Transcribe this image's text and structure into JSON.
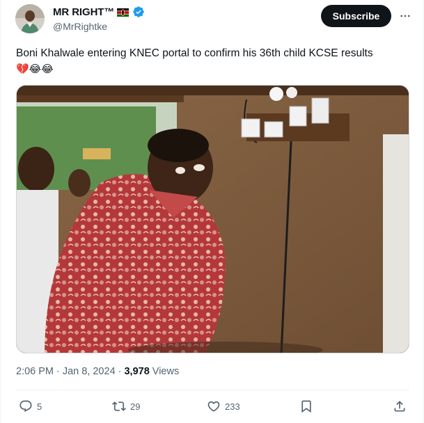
{
  "author": {
    "display_name": "MR RIGHT™",
    "handle": "@MrRightke",
    "verified": true
  },
  "header": {
    "subscribe_label": "Subscribe"
  },
  "tweet": {
    "text": "Boni Khalwale entering KNEC portal to confirm his 36th child KCSE results",
    "emojis": "💔😂😂"
  },
  "meta": {
    "time": "2:06 PM",
    "separator": "·",
    "date": "Jan 8, 2024",
    "views_count": "3,978",
    "views_label": "Views"
  },
  "actions": {
    "replies": "5",
    "reposts": "29",
    "likes": "233"
  },
  "icons": [
    "avatar",
    "kenya-flag-icon",
    "verified-badge-icon",
    "more-icon",
    "reply-icon",
    "repost-icon",
    "like-icon",
    "bookmark-icon",
    "share-icon"
  ],
  "colors": {
    "text": "#0f1419",
    "secondary": "#536471",
    "verified": "#1d9bf0",
    "button_bg": "#0f1419"
  }
}
